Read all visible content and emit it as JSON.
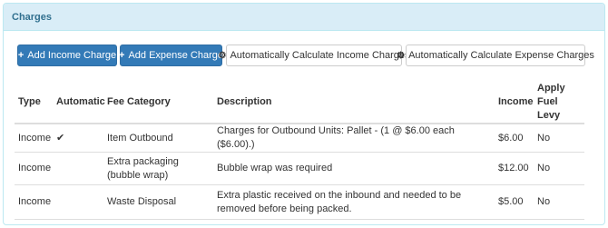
{
  "panel": {
    "title": "Charges"
  },
  "buttons": {
    "add_income": "Add Income Charge",
    "add_expense": "Add Expense Charge",
    "calc_income": "Automatically Calculate Income Charges",
    "calc_expense": "Automatically Calculate Expense Charges"
  },
  "table": {
    "headers": {
      "type": "Type",
      "automatic": "Automatic",
      "fee_category": "Fee Category",
      "description": "Description",
      "income": "Income",
      "apply_fuel_levy": "Apply Fuel Levy"
    },
    "rows": [
      {
        "type": "Income",
        "automatic": "✔",
        "fee_category": "Item Outbound",
        "description": "Charges for Outbound Units: Pallet - (1 @ $6.00 each ($6.00).)",
        "income": "$6.00",
        "apply_fuel_levy": "No"
      },
      {
        "type": "Income",
        "automatic": "",
        "fee_category": "Extra packaging (bubble wrap)",
        "description": "Bubble wrap was required",
        "income": "$12.00",
        "apply_fuel_levy": "No"
      },
      {
        "type": "Income",
        "automatic": "",
        "fee_category": "Waste Disposal",
        "description": "Extra plastic received on the inbound and needed to be removed before being packed.",
        "income": "$5.00",
        "apply_fuel_levy": "No"
      }
    ]
  },
  "icons": {
    "add": "plus-icon",
    "calculate": "gear-icon",
    "automatic": "check-icon"
  },
  "colors": {
    "primary": "#337ab7",
    "heading_bg": "#d9edf7",
    "heading_text": "#31708f"
  }
}
